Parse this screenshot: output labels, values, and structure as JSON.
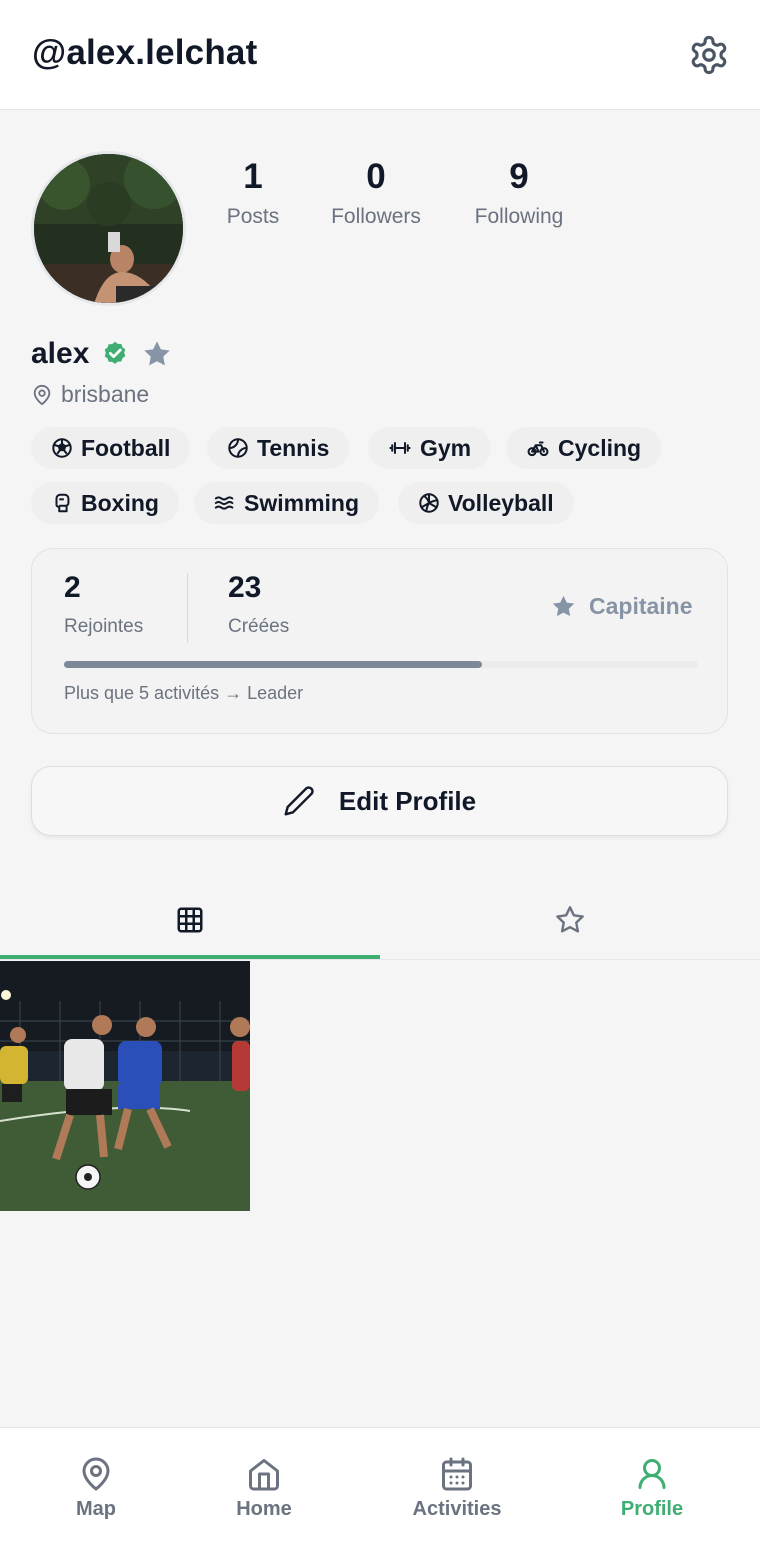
{
  "header": {
    "username": "@alex.lelchat"
  },
  "stats": [
    {
      "value": "1",
      "label": "Posts"
    },
    {
      "value": "0",
      "label": "Followers"
    },
    {
      "value": "9",
      "label": "Following"
    }
  ],
  "profile": {
    "name": "alex",
    "location": "brisbane",
    "verified": true
  },
  "sports": [
    {
      "label": "Football",
      "icon": "football-icon"
    },
    {
      "label": "Tennis",
      "icon": "tennis-icon"
    },
    {
      "label": "Gym",
      "icon": "dumbbell-icon"
    },
    {
      "label": "Cycling",
      "icon": "bike-icon"
    },
    {
      "label": "Boxing",
      "icon": "boxing-glove-icon"
    },
    {
      "label": "Swimming",
      "icon": "waves-icon"
    },
    {
      "label": "Volleyball",
      "icon": "volleyball-icon"
    }
  ],
  "activity_card": {
    "joined_value": "2",
    "joined_label": "Rejointes",
    "created_value": "23",
    "created_label": "Créées",
    "rank_label": "Capitaine",
    "progress_fraction": 0.66,
    "hint": "Plus que 5 activités → Leader"
  },
  "edit_button": {
    "label": "Edit Profile"
  },
  "tabs": [
    {
      "name": "grid",
      "icon": "grid-icon",
      "active": true
    },
    {
      "name": "favorites",
      "icon": "star-icon",
      "active": false
    }
  ],
  "nav": [
    {
      "label": "Map",
      "icon": "map-pin-icon",
      "active": false
    },
    {
      "label": "Home",
      "icon": "home-icon",
      "active": false
    },
    {
      "label": "Activities",
      "icon": "calendar-icon",
      "active": false
    },
    {
      "label": "Profile",
      "icon": "user-icon",
      "active": true
    }
  ],
  "colors": {
    "accent": "#3fae72",
    "muted_text": "#6b7280",
    "rank": "#8794a5",
    "progress_fill": "#7a8898",
    "background": "#f5f5f5"
  }
}
